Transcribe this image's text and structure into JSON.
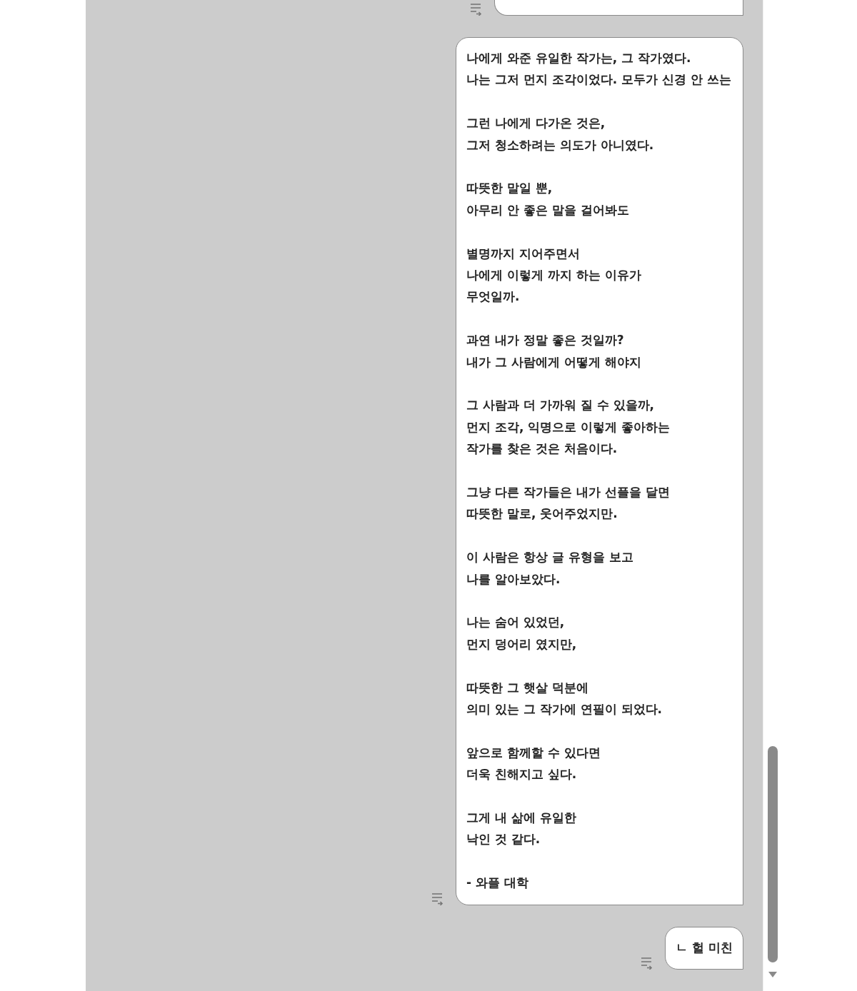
{
  "messages": [
    {
      "cut_off": true
    },
    {
      "cut_off": false,
      "paragraphs": [
        [
          "나에게 와준 유일한 작가는, 그 작가였다.",
          "나는 그저 먼지 조각이었다. 모두가 신경 안 쓰는"
        ],
        [
          "그런 나에게 다가온 것은,",
          "그저 청소하려는 의도가 아니였다."
        ],
        [
          "따뜻한 말일 뿐,",
          "아무리 안 좋은 말을 걸어봐도"
        ],
        [
          "별명까지 지어주면서",
          "나에게 이렇게 까지 하는 이유가",
          "무엇일까."
        ],
        [
          "과연 내가 정말 좋은 것일까?",
          "내가 그 사람에게 어떻게 해야지"
        ],
        [
          "그 사람과 더 가까워 질 수 있을까,",
          "먼지 조각, 익명으로 이렇게 좋아하는",
          "작가를 찾은 것은 처음이다."
        ],
        [
          "그냥 다른 작가들은 내가 선플을 달면",
          "따뜻한 말로, 웃어주었지만."
        ],
        [
          "이 사람은 항상 글 유형을 보고",
          "나를 알아보았다."
        ],
        [
          "나는 숨어 있었던,",
          "먼지 덩어리 였지만,"
        ],
        [
          "따뜻한 그 햇살 덕분에",
          "의미 있는 그 작가에 연필이 되었다."
        ],
        [
          "앞으로 함께할 수 있다면",
          "더욱 친해지고 싶다."
        ],
        [
          "그게 내 삶에 유일한",
          "낙인 것 같다."
        ],
        [
          "- 와플 대학"
        ]
      ]
    },
    {
      "cut_off": false,
      "paragraphs": [
        [
          "ㄴ 헐 미친"
        ]
      ]
    }
  ]
}
